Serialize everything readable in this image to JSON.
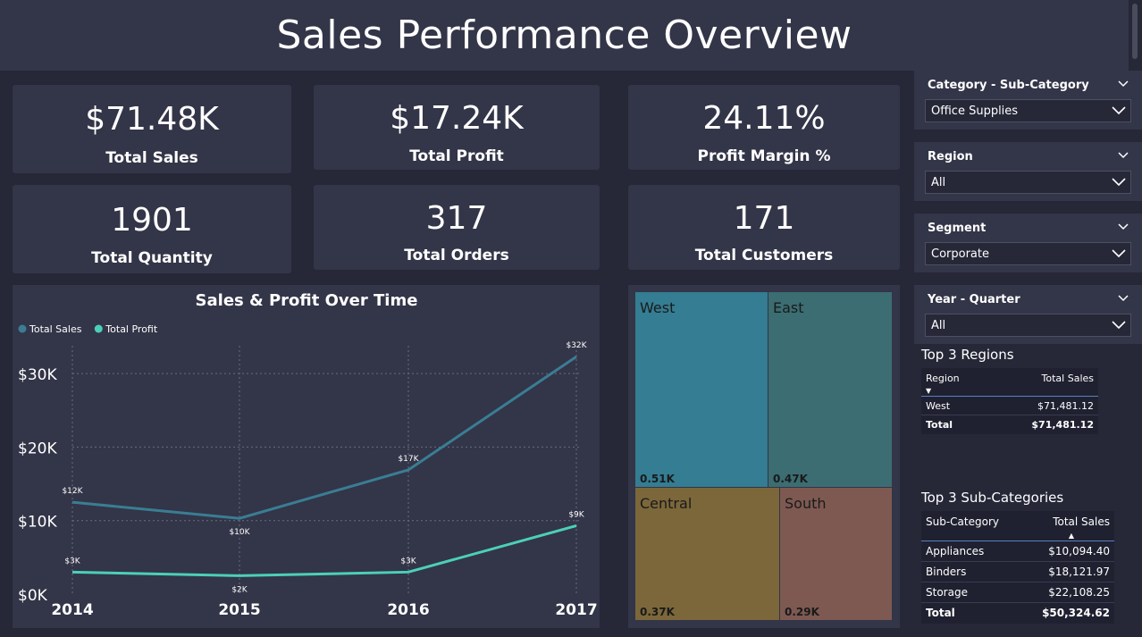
{
  "header": {
    "title": "Sales Performance Overview"
  },
  "kpis": {
    "total_sales": {
      "value": "$71.48K",
      "label": "Total Sales"
    },
    "total_profit": {
      "value": "$17.24K",
      "label": "Total Profit"
    },
    "profit_margin": {
      "value": "24.11%",
      "label": "Profit Margin %"
    },
    "total_quantity": {
      "value": "1901",
      "label": "Total Quantity"
    },
    "total_orders": {
      "value": "317",
      "label": "Total Orders"
    },
    "total_customers": {
      "value": "171",
      "label": "Total Customers"
    }
  },
  "line_chart": {
    "title": "Sales & Profit Over Time"
  },
  "chart_data": [
    {
      "type": "line",
      "title": "Sales & Profit Over Time",
      "categories": [
        "2014",
        "2015",
        "2016",
        "2017"
      ],
      "y_ticks": [
        "$0K",
        "$10K",
        "$20K",
        "$30K"
      ],
      "ylim": [
        0,
        35000
      ],
      "grid": true,
      "legend_position": "top-left",
      "series": [
        {
          "name": "Total Sales",
          "color": "#3a7d94",
          "values": [
            12500,
            10300,
            16900,
            32300
          ],
          "labels": [
            "$12K",
            "$10K",
            "$17K",
            "$32K"
          ]
        },
        {
          "name": "Total Profit",
          "color": "#4bd0b8",
          "values": [
            3000,
            2500,
            3000,
            9300
          ],
          "labels": [
            "$3K",
            "$2K",
            "$3K",
            "$9K"
          ]
        }
      ]
    },
    {
      "type": "treemap",
      "items": [
        {
          "name": "West",
          "value": "0.51K",
          "color": "#347d93"
        },
        {
          "name": "East",
          "value": "0.47K",
          "color": "#3b6d72"
        },
        {
          "name": "Central",
          "value": "0.37K",
          "color": "#7b673a"
        },
        {
          "name": "South",
          "value": "0.29K",
          "color": "#7d5952"
        }
      ]
    }
  ],
  "slicers": [
    {
      "title": "Category - Sub-Category",
      "value": "Office Supplies"
    },
    {
      "title": "Region",
      "value": "All"
    },
    {
      "title": "Segment",
      "value": "Corporate"
    },
    {
      "title": "Year - Quarter",
      "value": "All"
    }
  ],
  "top_regions": {
    "title": "Top 3 Regions",
    "columns": [
      "Region",
      "Total Sales"
    ],
    "rows": [
      [
        "West",
        "$71,481.12"
      ]
    ],
    "total": [
      "Total",
      "$71,481.12"
    ]
  },
  "top_subcategories": {
    "title": "Top 3 Sub-Categories",
    "columns": [
      "Sub-Category",
      "Total Sales"
    ],
    "rows": [
      [
        "Appliances",
        "$10,094.40"
      ],
      [
        "Binders",
        "$18,121.97"
      ],
      [
        "Storage",
        "$22,108.25"
      ]
    ],
    "total": [
      "Total",
      "$50,324.62"
    ]
  }
}
